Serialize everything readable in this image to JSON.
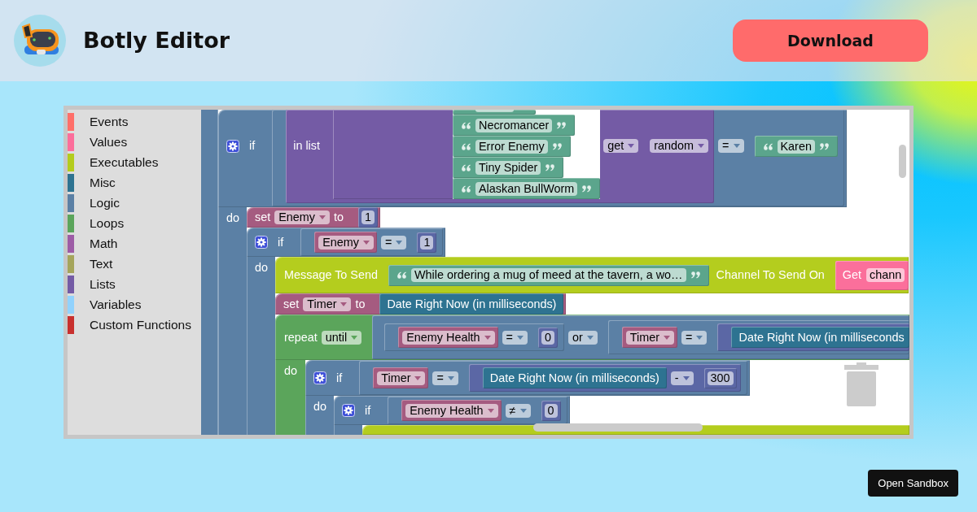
{
  "header": {
    "title": "Botly Editor",
    "download_button": "Download"
  },
  "toolbox": {
    "categories": [
      {
        "label": "Events",
        "color": "#ff6f69"
      },
      {
        "label": "Values",
        "color": "#fc6e9b"
      },
      {
        "label": "Executables",
        "color": "#b4cc1d"
      },
      {
        "label": "Misc",
        "color": "#2e7391"
      },
      {
        "label": "Logic",
        "color": "#5b80a5"
      },
      {
        "label": "Loops",
        "color": "#5ba55b"
      },
      {
        "label": "Math",
        "color": "#9d5ca6"
      },
      {
        "label": "Text",
        "color": "#a5a55b"
      },
      {
        "label": "Lists",
        "color": "#745ba5"
      },
      {
        "label": "Variables",
        "color": "#91d2fd"
      },
      {
        "label": "Custom Functions",
        "color": "#c8302e"
      }
    ]
  },
  "workspace": {
    "blocks": [
      {
        "kind": "if",
        "label": "if",
        "condition": {
          "kind": "compare",
          "left": {
            "kind": "list_get",
            "label": "in list",
            "list": {
              "kind": "list_create",
              "items": [
                {
                  "kind": "text"
                },
                {
                  "kind": "text",
                  "value": "Necromancer"
                },
                {
                  "kind": "text",
                  "value": "Error Enemy"
                },
                {
                  "kind": "text",
                  "value": "Tiny Spider"
                },
                {
                  "kind": "text",
                  "value": "Alaskan BullWorm"
                }
              ]
            },
            "mode": "get",
            "where": "random"
          },
          "operator": "=",
          "right": {
            "kind": "text",
            "value": "Karen"
          }
        },
        "do_label": "do",
        "statements": [
          {
            "kind": "set",
            "label": "set",
            "variable": "Enemy",
            "to_label": "to",
            "value": {
              "kind": "number",
              "value": "1"
            }
          },
          {
            "kind": "if",
            "label": "if",
            "condition": {
              "kind": "compare",
              "left": {
                "kind": "variable",
                "name": "Enemy"
              },
              "operator": "=",
              "right": {
                "kind": "number",
                "value": "1"
              }
            },
            "do_label": "do",
            "statements": [
              {
                "kind": "executable",
                "label": "Message To Send",
                "input": {
                  "kind": "text",
                  "value": "While ordering a mug of meed at the tavern, a wo…"
                },
                "label_2": "Channel To Send On",
                "input_2": {
                  "kind": "value_get",
                  "label": "Get",
                  "field": "chann"
                }
              },
              {
                "kind": "set",
                "label": "set",
                "variable": "Timer",
                "to_label": "to",
                "value": {
                  "kind": "date",
                  "label": "Date Right Now (in milliseconds)"
                }
              },
              {
                "kind": "repeat",
                "label": "repeat",
                "mode": "until",
                "condition": {
                  "kind": "logic_op",
                  "left": {
                    "kind": "compare",
                    "left": {
                      "kind": "variable",
                      "name": "Enemy Health"
                    },
                    "operator": "=",
                    "right": {
                      "kind": "number",
                      "value": "0"
                    }
                  },
                  "operator": "or",
                  "right": {
                    "kind": "compare",
                    "left": {
                      "kind": "variable",
                      "name": "Timer"
                    },
                    "operator": "=",
                    "right": {
                      "kind": "arithmetic",
                      "left": {
                        "kind": "date",
                        "label": "Date Right Now (in milliseconds"
                      }
                    }
                  }
                },
                "do_label": "do",
                "statements": [
                  {
                    "kind": "if",
                    "label": "if",
                    "condition": {
                      "kind": "compare",
                      "left": {
                        "kind": "variable",
                        "name": "Timer"
                      },
                      "operator": "=",
                      "right": {
                        "kind": "arithmetic",
                        "left": {
                          "kind": "date",
                          "label": "Date Right Now (in milliseconds)"
                        },
                        "operator": "-",
                        "right": {
                          "kind": "number",
                          "value": "300"
                        }
                      }
                    },
                    "do_label": "do",
                    "statements": [
                      {
                        "kind": "if",
                        "label": "if",
                        "condition": {
                          "kind": "compare",
                          "left": {
                            "kind": "variable",
                            "name": "Enemy Health"
                          },
                          "operator": "≠",
                          "right": {
                            "kind": "number",
                            "value": "0"
                          }
                        },
                        "statements": [
                          {
                            "kind": "executable"
                          }
                        ]
                      }
                    ]
                  }
                ]
              }
            ]
          }
        ]
      }
    ]
  },
  "sandbox_button": "Open Sandbox"
}
